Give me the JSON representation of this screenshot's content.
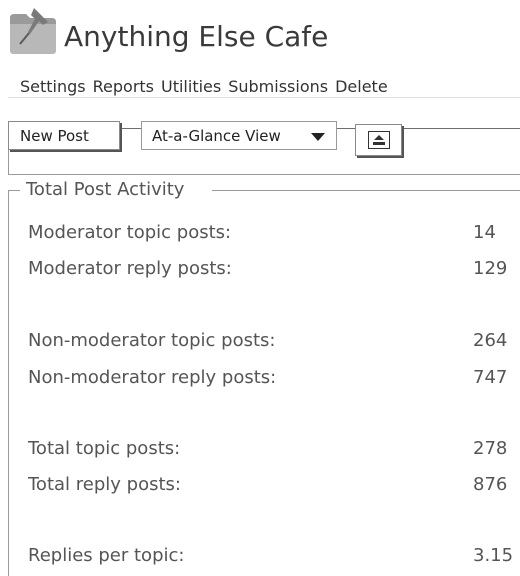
{
  "app": {
    "title": "Anything Else Cafe",
    "icon": "folder-with-pin-icon"
  },
  "menu": [
    "Settings",
    "Reports",
    "Utilities",
    "Submissions",
    "Delete"
  ],
  "toolbar": {
    "new_post_label": "New Post",
    "view_selected": "At-a-Glance View",
    "view_dropdown_icon": "triangle-down-icon",
    "collapse_icon": "panel-collapse-icon"
  },
  "activity": {
    "title": "Total Post Activity",
    "rows": [
      {
        "label": "Moderator topic posts:",
        "value": "14"
      },
      {
        "label": "Moderator reply posts:",
        "value": "129"
      },
      {
        "label": "Non-moderator topic posts:",
        "value": "264"
      },
      {
        "label": "Non-moderator reply posts:",
        "value": "747"
      },
      {
        "label": "Total topic posts:",
        "value": "278"
      },
      {
        "label": "Total reply posts:",
        "value": "876"
      },
      {
        "label": "Replies per topic:",
        "value": "3.15"
      }
    ]
  }
}
